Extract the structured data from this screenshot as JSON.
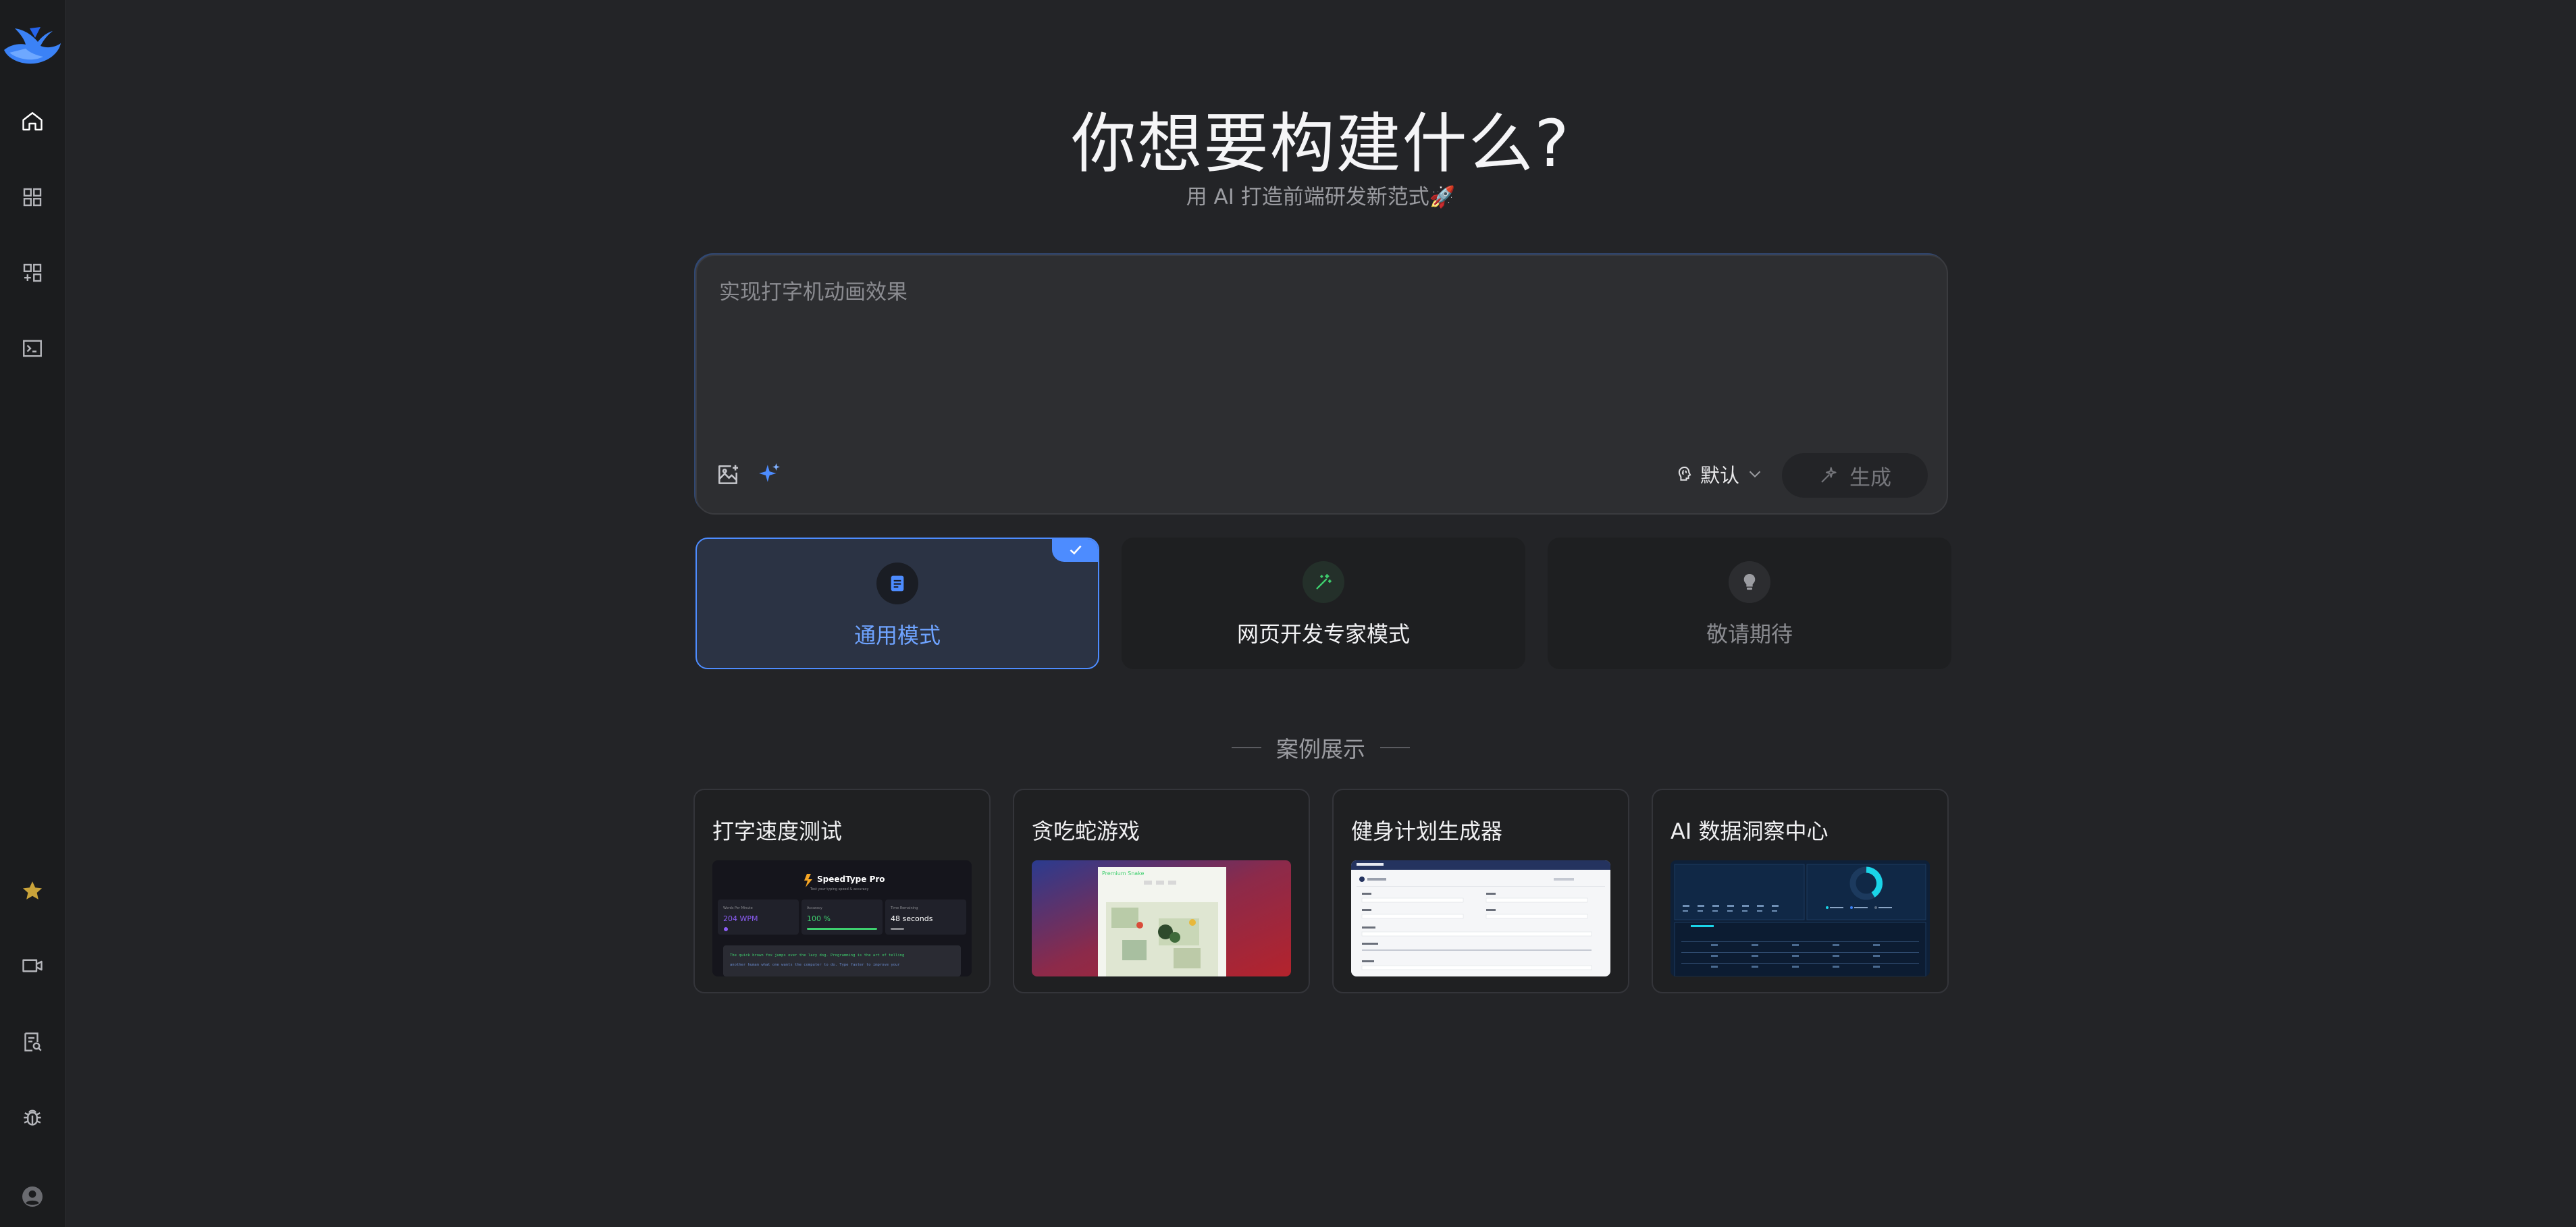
{
  "sidebar": {
    "logo": "whale-logo",
    "top_items": [
      {
        "name": "home",
        "icon": "home-icon"
      },
      {
        "name": "apps",
        "icon": "grid-icon"
      },
      {
        "name": "add-app",
        "icon": "grid-add-icon"
      },
      {
        "name": "terminal",
        "icon": "terminal-icon"
      }
    ],
    "bottom_items": [
      {
        "name": "favorites",
        "icon": "star-icon"
      },
      {
        "name": "video",
        "icon": "video-icon"
      },
      {
        "name": "docs",
        "icon": "document-search-icon"
      },
      {
        "name": "debug",
        "icon": "bug-icon"
      },
      {
        "name": "account",
        "icon": "avatar-icon"
      }
    ]
  },
  "hero": {
    "title": "你想要构建什么?",
    "subtitle": "用 AI 打造前端研发新范式🚀"
  },
  "prompt": {
    "placeholder": "实现打字机动画效果",
    "value": "",
    "model_label": "默认",
    "generate_label": "生成"
  },
  "modes": [
    {
      "label": "通用模式",
      "selected": true,
      "icon": "document-icon",
      "color": "#4d8cff"
    },
    {
      "label": "网页开发专家模式",
      "selected": false,
      "icon": "magic-wand-icon",
      "color": "#3ecf6e"
    },
    {
      "label": "敬请期待",
      "selected": false,
      "icon": "lightbulb-icon",
      "color": "#8a8b90"
    }
  ],
  "showcase": {
    "title": "案例展示",
    "cases": [
      {
        "title": "打字速度测试"
      },
      {
        "title": "贪吃蛇游戏"
      },
      {
        "title": "健身计划生成器"
      },
      {
        "title": "AI 数据洞察中心"
      }
    ]
  },
  "thumb_typing": {
    "app_name": "SpeedType Pro",
    "tagline": "Test your typing speed & accuracy",
    "stat1_label": "Words Per Minute",
    "stat1_value": "204 WPM",
    "stat2_label": "Accuracy",
    "stat2_value": "100 %",
    "stat3_label": "Time Remaining",
    "stat3_value": "48 seconds",
    "sample_line1": "The quick brown fox jumps over the lazy dog. Programming is the art of telling",
    "sample_line2": "another human what one wants the computer to do. Type faster to improve your"
  },
  "thumb_snake": {
    "title": "Premium Snake"
  },
  "colors": {
    "background": "#232427",
    "sidebar": "#1b1c1e",
    "accent": "#4d8cff",
    "card": "#1e1f21",
    "star": "#c9a33a"
  }
}
